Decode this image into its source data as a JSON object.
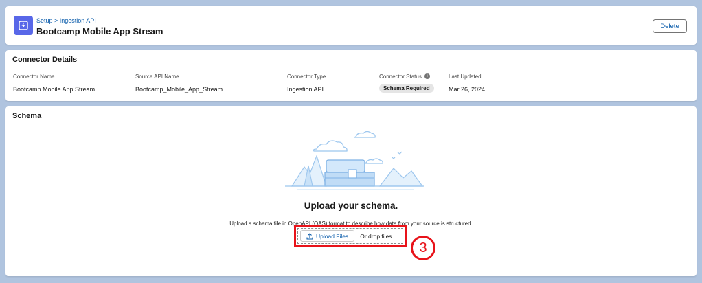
{
  "header": {
    "breadcrumb": "Setup > Ingestion API",
    "title": "Bootcamp Mobile App Stream",
    "delete_label": "Delete",
    "icon": "lightning-bolt-icon"
  },
  "connector_details": {
    "section_title": "Connector Details",
    "fields": [
      {
        "label": "Connector Name",
        "value": "Bootcamp Mobile App Stream"
      },
      {
        "label": "Source API Name",
        "value": "Bootcamp_Mobile_App_Stream"
      },
      {
        "label": "Connector Type",
        "value": "Ingestion API"
      },
      {
        "label": "Connector Status",
        "value": "Schema Required"
      },
      {
        "label": "Last Updated",
        "value": "Mar 26, 2024"
      }
    ]
  },
  "schema": {
    "section_title": "Schema",
    "heading": "Upload your schema.",
    "description": "Upload a schema file in OpenAPI (OAS) format to describe how data from your source is structured.",
    "upload_label": "Upload Files",
    "drop_label": "Or drop files",
    "step_number": "3"
  },
  "colors": {
    "page_bg": "#b0c4df",
    "brand_icon": "#5867e8",
    "link": "#0b5cab",
    "highlight": "#e8131a"
  }
}
